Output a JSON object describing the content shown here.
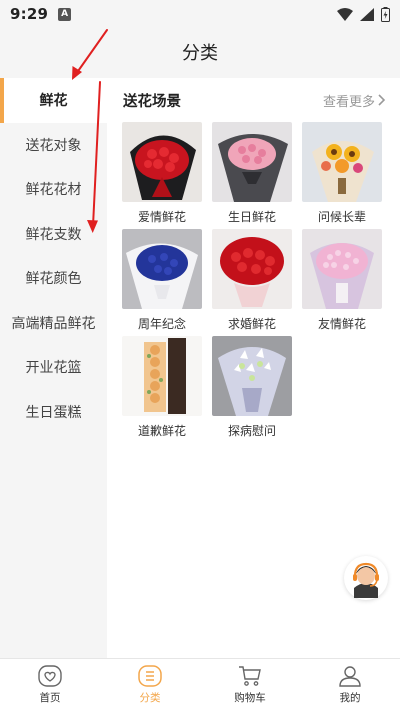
{
  "status_bar": {
    "time": "9:29",
    "notification_glyph": "A"
  },
  "header": {
    "title": "分类"
  },
  "sidebar": {
    "items": [
      {
        "label": "鲜花",
        "active": true
      },
      {
        "label": "送花对象"
      },
      {
        "label": "鲜花花材"
      },
      {
        "label": "鲜花支数"
      },
      {
        "label": "鲜花颜色"
      },
      {
        "label": "高端精品鲜花"
      },
      {
        "label": "开业花篮"
      },
      {
        "label": "生日蛋糕"
      }
    ]
  },
  "main": {
    "section_title": "送花场景",
    "see_more": "查看更多",
    "items": [
      {
        "label": "爱情鲜花"
      },
      {
        "label": "生日鲜花"
      },
      {
        "label": "问候长辈"
      },
      {
        "label": "周年纪念"
      },
      {
        "label": "求婚鲜花"
      },
      {
        "label": "友情鲜花"
      },
      {
        "label": "道歉鲜花"
      },
      {
        "label": "探病慰问"
      }
    ]
  },
  "tabbar": {
    "tabs": [
      {
        "label": "首页"
      },
      {
        "label": "分类",
        "active": true
      },
      {
        "label": "购物车"
      },
      {
        "label": "我的"
      }
    ]
  },
  "colors": {
    "accent": "#f3a64a",
    "annotation_arrow": "#e02020"
  },
  "icons": {
    "status_right": [
      "wifi-icon",
      "signal-icon",
      "battery-icon"
    ],
    "see_more": "chevron-right-icon",
    "fab": "customer-service-icon",
    "tabs": [
      "home-heart-icon",
      "category-icon",
      "cart-icon",
      "user-icon"
    ]
  }
}
